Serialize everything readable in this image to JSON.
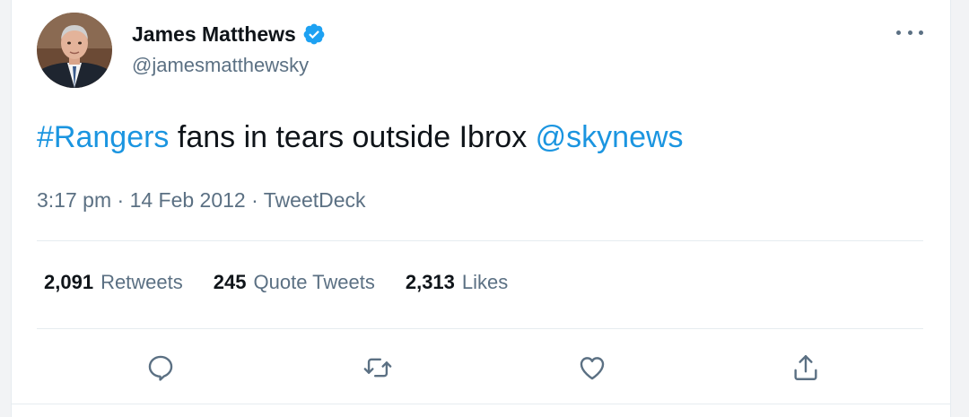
{
  "tweet": {
    "author": {
      "display_name": "James Matthews",
      "handle": "@jamesmatthewsky",
      "verified": true
    },
    "text": {
      "hashtag": "#Rangers",
      "body": " fans in tears outside Ibrox ",
      "mention": "@skynews"
    },
    "meta": {
      "time": "3:17 pm",
      "separator1": " · ",
      "date": "14 Feb 2012",
      "separator2": " · ",
      "source": "TweetDeck"
    },
    "stats": {
      "retweets_count": "2,091",
      "retweets_label": "Retweets",
      "quotes_count": "245",
      "quotes_label": "Quote Tweets",
      "likes_count": "2,313",
      "likes_label": "Likes"
    },
    "actions": [
      {
        "icon": "reply-icon"
      },
      {
        "icon": "retweet-icon"
      },
      {
        "icon": "like-icon"
      },
      {
        "icon": "share-icon"
      }
    ]
  },
  "colors": {
    "link": "#1b95e0",
    "secondary_text": "#5b7083",
    "primary_text": "#0f1419",
    "divider": "#e6ecf0",
    "verified_badge": "#1da1f2"
  }
}
